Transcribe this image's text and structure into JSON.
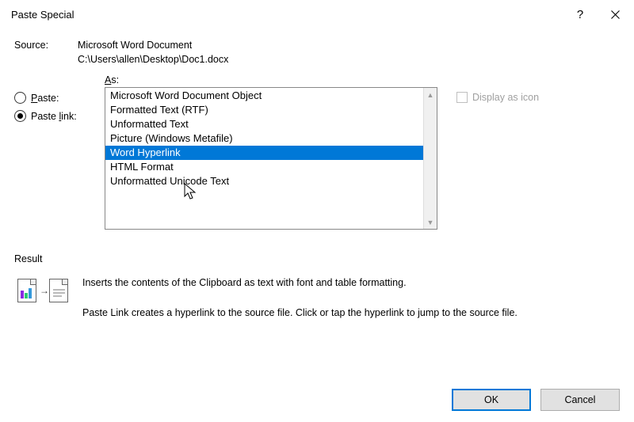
{
  "title": "Paste Special",
  "source": {
    "label": "Source:",
    "app": "Microsoft Word Document",
    "path": "C:\\Users\\allen\\Desktop\\Doc1.docx"
  },
  "radios": {
    "paste": {
      "label_pre": "P",
      "label_post": "aste:",
      "selected": false
    },
    "paste_link": {
      "label_pre": "Paste ",
      "label_key": "l",
      "label_post": "ink:",
      "selected": true
    }
  },
  "as_label_pre": "A",
  "as_label_post": "s:",
  "list": {
    "items": [
      "Microsoft Word Document Object",
      "Formatted Text (RTF)",
      "Unformatted Text",
      "Picture (Windows Metafile)",
      "Word Hyperlink",
      "HTML Format",
      "Unformatted Unicode Text"
    ],
    "selected_index": 4
  },
  "display_as_icon": {
    "label_pre": "D",
    "label_post": "isplay as icon",
    "checked": false,
    "enabled": false
  },
  "result": {
    "label": "Result",
    "line1": "Inserts the contents of the Clipboard as text with font and table formatting.",
    "line2": "Paste Link creates a hyperlink to the source file. Click or tap the hyperlink to jump to the source file."
  },
  "buttons": {
    "ok": "OK",
    "cancel": "Cancel"
  }
}
